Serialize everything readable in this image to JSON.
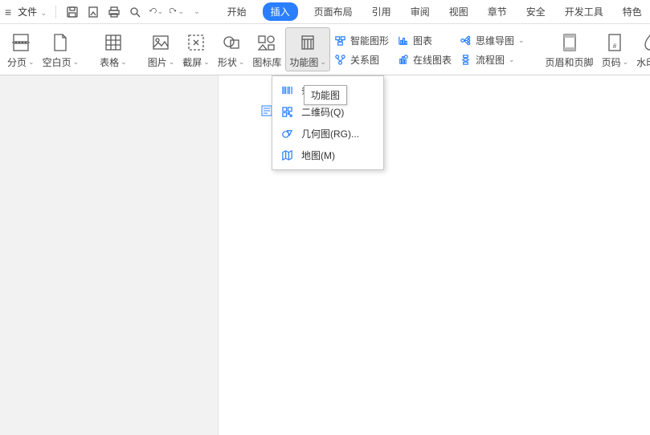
{
  "menubar": {
    "file_label": "文件"
  },
  "tabs": {
    "start": "开始",
    "insert": "插入",
    "layout": "页面布局",
    "reference": "引用",
    "review": "审阅",
    "view": "视图",
    "chapter": "章节",
    "security": "安全",
    "developer": "开发工具",
    "special": "特色"
  },
  "ribbon": {
    "page_break": "分页",
    "blank_page": "空白页",
    "table": "表格",
    "picture": "图片",
    "screenshot": "截屏",
    "shapes": "形状",
    "icon_lib": "图标库",
    "function_chart": "功能图",
    "smart_graphic": "智能图形",
    "chart": "图表",
    "relation": "关系图",
    "online_chart": "在线图表",
    "mind_map": "思维导图",
    "flow_chart": "流程图",
    "header_footer": "页眉和页脚",
    "page_number": "页码",
    "watermark": "水印"
  },
  "dropdown": {
    "barcode": "条形码(R)",
    "qrcode": "二维码(Q)",
    "geometry": "几何图(RG)...",
    "map": "地图(M)"
  },
  "tooltip": {
    "text": "功能图"
  }
}
